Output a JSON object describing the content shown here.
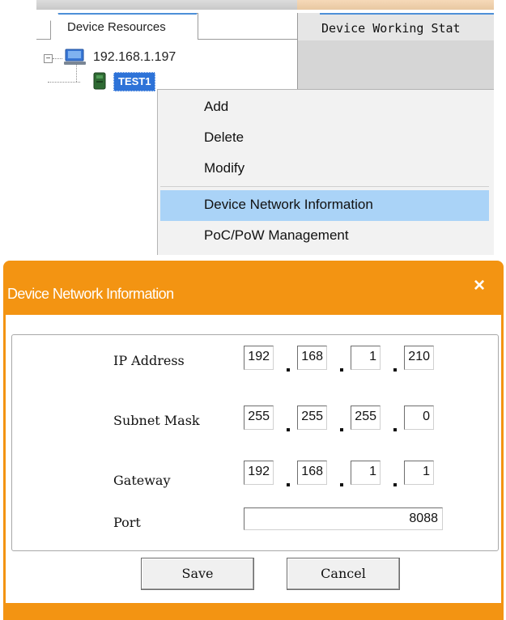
{
  "top_panel": {
    "tabs": {
      "resources": "Device Resources",
      "working": "Device Working Stat"
    },
    "tree": {
      "host": "192.168.1.197",
      "device": "TEST1",
      "expander": "−"
    },
    "context_menu": {
      "items": [
        "Add",
        "Delete",
        "Modify",
        "Device Network Information",
        "PoC/PoW Management"
      ],
      "highlighted": "Device Network Information"
    }
  },
  "dialog": {
    "title": "Device Network Information",
    "close_icon": "×",
    "fields": {
      "ip_label": "IP  Address",
      "ip": [
        "192",
        "168",
        "1",
        "210"
      ],
      "subnet_label": "Subnet Mask",
      "subnet": [
        "255",
        "255",
        "255",
        "0"
      ],
      "gateway_label": "Gateway",
      "gateway": [
        "192",
        "168",
        "1",
        "1"
      ],
      "port_label": "Port",
      "port": "8088"
    },
    "buttons": {
      "save": "Save",
      "cancel": "Cancel"
    }
  },
  "colors": {
    "accent_orange": "#f39412",
    "selection_blue": "#2e73d8",
    "menu_highlight": "#aad3f7"
  }
}
